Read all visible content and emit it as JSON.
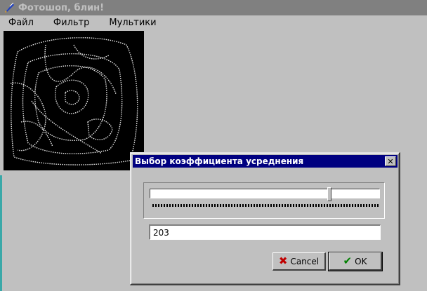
{
  "window": {
    "title": "Фотошоп, блин!"
  },
  "menu": {
    "items": [
      {
        "label": "Файл"
      },
      {
        "label": "Фильтр"
      },
      {
        "label": "Мультики"
      }
    ]
  },
  "dialog": {
    "title": "Выбор коэффициента усреднения",
    "close_glyph": "✕",
    "slider": {
      "value_fraction": 0.79
    },
    "value_field": {
      "value": "203"
    },
    "cancel_button": {
      "label": "Cancel",
      "icon": "close-x-icon",
      "icon_color": "#c00000"
    },
    "ok_button": {
      "label": "OK",
      "icon": "checkmark-icon",
      "icon_color": "#008000"
    }
  },
  "colors": {
    "dialog_titlebar": "#000080",
    "inactive_titlebar": "#808080",
    "face": "#c0c0c0"
  }
}
